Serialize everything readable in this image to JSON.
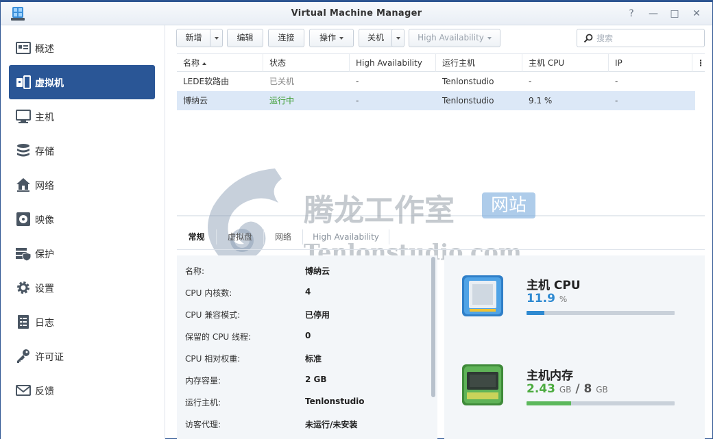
{
  "window": {
    "title": "Virtual Machine Manager",
    "controls": [
      "?",
      "—",
      "□",
      "✕"
    ]
  },
  "sidebar": {
    "items": [
      {
        "label": "概述",
        "icon": "overview-icon"
      },
      {
        "label": "虚拟机",
        "icon": "virtual-machine-icon",
        "active": true
      },
      {
        "label": "主机",
        "icon": "host-monitor-icon"
      },
      {
        "label": "存储",
        "icon": "storage-icon"
      },
      {
        "label": "网络",
        "icon": "network-icon"
      },
      {
        "label": "映像",
        "icon": "image-disc-icon"
      },
      {
        "label": "保护",
        "icon": "protection-icon"
      },
      {
        "label": "设置",
        "icon": "gear-icon"
      },
      {
        "label": "日志",
        "icon": "log-icon"
      },
      {
        "label": "许可证",
        "icon": "key-icon"
      },
      {
        "label": "反馈",
        "icon": "mail-icon"
      }
    ]
  },
  "toolbar": {
    "create": "新增",
    "edit": "编辑",
    "connect": "连接",
    "action": "操作",
    "shutdown": "关机",
    "high_availability": "High Availability",
    "search_placeholder": "搜索"
  },
  "table": {
    "columns": [
      "名称",
      "状态",
      "High Availability",
      "运行主机",
      "主机 CPU",
      "IP"
    ],
    "rows": [
      {
        "name": "LEDE软路由",
        "status": "已关机",
        "ha": "-",
        "host": "Tenlonstudio",
        "cpu": "-",
        "ip": "-"
      },
      {
        "name": "博纳云",
        "status": "运行中",
        "ha": "-",
        "host": "Tenlonstudio",
        "cpu": "9.1 %",
        "ip": "-"
      }
    ]
  },
  "tabs": [
    "常规",
    "虚拟盘",
    "网络",
    "High Availability"
  ],
  "details": [
    {
      "label": "名称:",
      "value": "博纳云"
    },
    {
      "label": "CPU 内核数:",
      "value": "4"
    },
    {
      "label": "CPU 兼容模式:",
      "value": "已停用"
    },
    {
      "label": "保留的 CPU 线程:",
      "value": "0"
    },
    {
      "label": "CPU 相对权重:",
      "value": "标准"
    },
    {
      "label": "内存容量:",
      "value": "2 GB"
    },
    {
      "label": "运行主机:",
      "value": "Tenlonstudio"
    },
    {
      "label": "访客代理:",
      "value": "未运行/未安装"
    }
  ],
  "resources": {
    "cpu": {
      "title": "主机 CPU",
      "value": "11.9",
      "unit": "%",
      "fraction": 0.119
    },
    "memory": {
      "title": "主机内存",
      "used": "2.43",
      "used_unit": "GB",
      "sep": "/",
      "total": "8",
      "total_unit": "GB",
      "fraction": 0.3
    }
  },
  "watermark": {
    "text_cn": "腾龙工作室",
    "badge": "网站",
    "text_en": "Tenlonstudio.com"
  },
  "colors": {
    "accent": "#2a5696",
    "running": "#3a9b2f",
    "cpu_bar": "#2f8ad1",
    "mem_bar": "#5cb85c"
  }
}
